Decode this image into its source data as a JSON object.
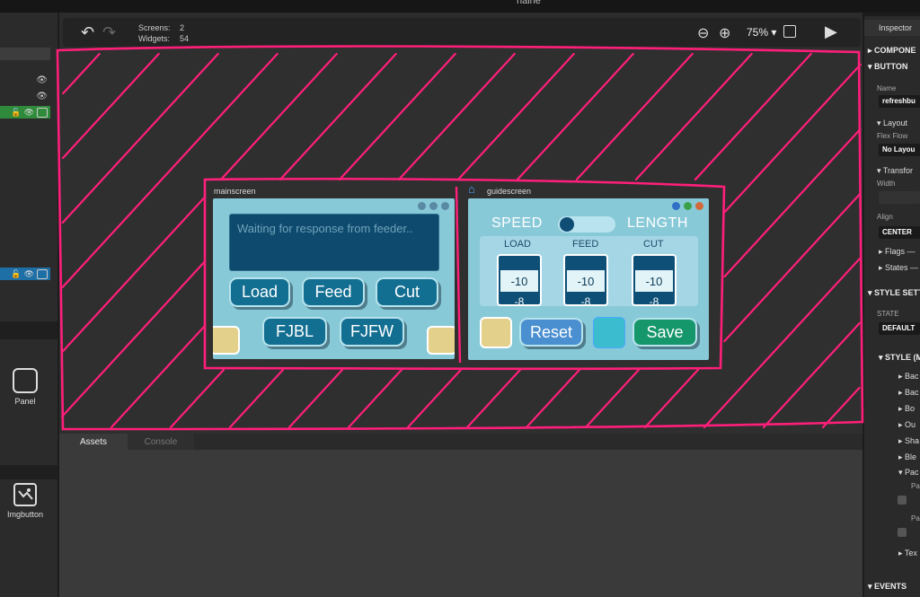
{
  "window": {
    "title": "naine"
  },
  "toolbar": {
    "screens_label": "Screens:",
    "screens_value": "2",
    "widgets_label": "Widgets:",
    "widgets_value": "54",
    "zoom": "75%"
  },
  "widgets": [
    {
      "label": "Panel"
    },
    {
      "label": "Imgbutton"
    }
  ],
  "screens": {
    "main": {
      "title": "mainscreen",
      "placeholder": "Waiting for response from feeder..",
      "buttons": [
        "Load",
        "Feed",
        "Cut",
        "FJBL",
        "FJFW"
      ]
    },
    "guide": {
      "title": "guidescreen",
      "speed_label": "SPEED",
      "length_label": "LENGTH",
      "rollers": [
        {
          "label": "LOAD",
          "value": "-10",
          "next": "-8"
        },
        {
          "label": "FEED",
          "value": "-10",
          "next": "-8"
        },
        {
          "label": "CUT",
          "value": "-10",
          "next": "-8"
        }
      ],
      "reset_label": "Reset",
      "save_label": "Save"
    }
  },
  "bottom_tabs": [
    "Assets",
    "Console"
  ],
  "inspector": {
    "title": "Inspector",
    "sections": {
      "components": "COMPONE",
      "button": "BUTTON",
      "name_label": "Name",
      "name_value": "refreshbu",
      "layout": "Layout",
      "flex_flow_label": "Flex Flow",
      "flex_flow_value": "No Layou",
      "transform": "Transfor",
      "width_label": "Width",
      "align_label": "Align",
      "align_value": "CENTER",
      "flags": "Flags",
      "states": "States",
      "style_settings": "STYLE SETT",
      "state_label": "STATE",
      "state_value": "DEFAULT",
      "style": "STYLE (M",
      "style_items": [
        "Bac",
        "Bac",
        "Bo",
        "Ou",
        "Sha",
        "Ble",
        "Pac"
      ],
      "pa1": "Pa",
      "pa2": "Pa",
      "text": "Tex",
      "events": "EVENTS"
    }
  },
  "colors": {
    "annotation": "#ff1f7a",
    "screen_bg": "#88c9d8",
    "button_blue": "#136f92",
    "reset_blue": "#4a8fd0",
    "save_green": "#16966b",
    "accent_yellow": "#e3d08b",
    "selected_teal": "#3bbccf"
  }
}
